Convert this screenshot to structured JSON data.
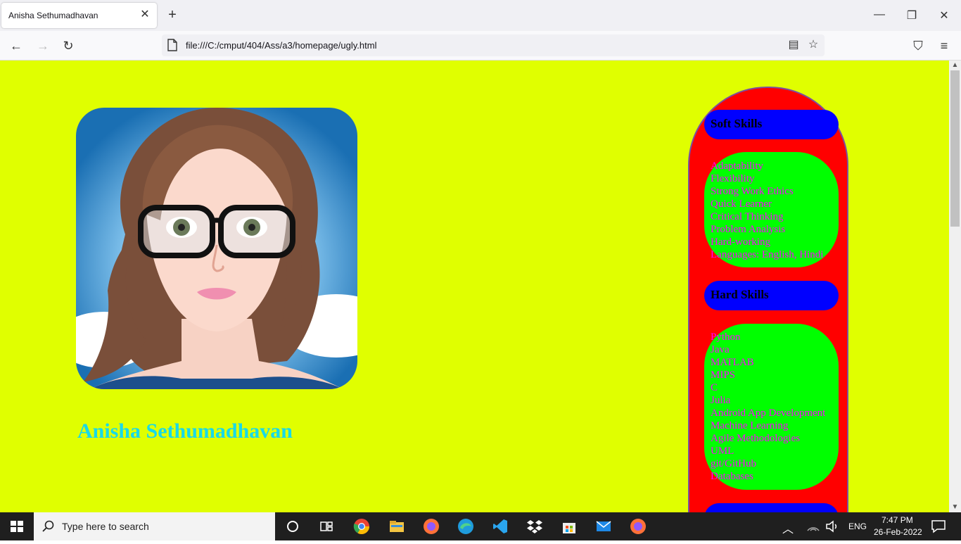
{
  "browser": {
    "tab_title": "Anisha Sethumadhavan",
    "url": "file:///C:/cmput/404/Ass/a3/homepage/ugly.html"
  },
  "page": {
    "name": "Anisha Sethumadhavan",
    "soft_skills": {
      "title": "Soft Skills",
      "items": [
        "Adaptability",
        "Flexibility",
        "Strong Work Ethics",
        "Quick Learner",
        "Critical Thinking",
        "Problem Analysis",
        "Hard-working",
        "Languages: English, Hindi"
      ]
    },
    "hard_skills": {
      "title": "Hard Skills",
      "items": [
        "Python",
        "Java",
        "MATLAB",
        "MIPS",
        "C",
        "Julia",
        "Android App Development",
        "Machine Learning",
        "Agile Methodologies",
        "UML",
        "git/GitHub",
        "Databases"
      ]
    },
    "colors": {
      "background": "#e0ff00",
      "panel": "#ff0000",
      "header": "#0000ff",
      "list": "#00ff00",
      "list_text": "#ff00ff",
      "name": "#18d9e8"
    }
  },
  "taskbar": {
    "search_placeholder": "Type here to search",
    "language": "ENG",
    "time": "7:47 PM",
    "date": "26-Feb-2022"
  }
}
